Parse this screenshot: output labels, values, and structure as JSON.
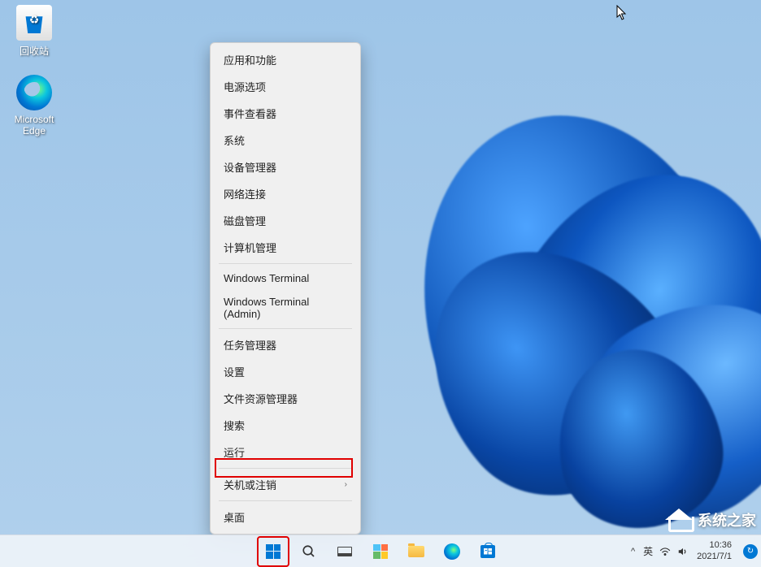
{
  "desktop": {
    "icons": [
      {
        "name": "recycle-bin",
        "label": "回收站"
      },
      {
        "name": "microsoft-edge",
        "label": "Microsoft Edge"
      }
    ]
  },
  "context_menu": {
    "items": [
      {
        "label": "应用和功能",
        "has_submenu": false
      },
      {
        "label": "电源选项",
        "has_submenu": false
      },
      {
        "label": "事件查看器",
        "has_submenu": false
      },
      {
        "label": "系统",
        "has_submenu": false
      },
      {
        "label": "设备管理器",
        "has_submenu": false
      },
      {
        "label": "网络连接",
        "has_submenu": false
      },
      {
        "label": "磁盘管理",
        "has_submenu": false
      },
      {
        "label": "计算机管理",
        "has_submenu": false
      },
      {
        "label": "Windows Terminal",
        "has_submenu": false
      },
      {
        "label": "Windows Terminal (Admin)",
        "has_submenu": false
      },
      {
        "label": "任务管理器",
        "has_submenu": false
      },
      {
        "label": "设置",
        "has_submenu": false
      },
      {
        "label": "文件资源管理器",
        "has_submenu": false
      },
      {
        "label": "搜索",
        "has_submenu": false
      },
      {
        "label": "运行",
        "has_submenu": false,
        "highlighted": true
      },
      {
        "label": "关机或注销",
        "has_submenu": true
      },
      {
        "label": "桌面",
        "has_submenu": false
      }
    ]
  },
  "taskbar": {
    "items": [
      {
        "name": "start",
        "highlighted": true
      },
      {
        "name": "search"
      },
      {
        "name": "task-view"
      },
      {
        "name": "widgets"
      },
      {
        "name": "file-explorer"
      },
      {
        "name": "microsoft-edge"
      },
      {
        "name": "microsoft-store"
      }
    ]
  },
  "systray": {
    "chevron": "^",
    "ime": "英",
    "wifi": "wifi-icon",
    "volume": "volume-icon",
    "time": "10:36",
    "date": "2021/7/1"
  },
  "watermark": {
    "text": "系统之家"
  }
}
